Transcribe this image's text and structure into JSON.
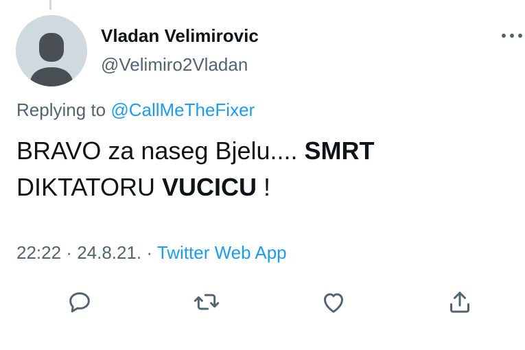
{
  "author": {
    "display_name": "Vladan Velimirovic",
    "handle": "@Velimiro2Vladan"
  },
  "reply": {
    "prefix": "Replying to ",
    "mention": "@CallMeTheFixer"
  },
  "tweet": {
    "text_part1": "BRAVO za naseg Bjelu.... ",
    "text_bold1": "SMRT",
    "text_part2": "DIKTATORU ",
    "text_bold2": "VUCICU",
    "text_part3": " !"
  },
  "meta": {
    "time": "22:22",
    "separator": " · ",
    "date": "24.8.21.",
    "source": "Twitter Web App"
  },
  "icons": {
    "more": "more-horizontal-icon",
    "reply": "reply-icon",
    "retweet": "retweet-icon",
    "like": "like-icon",
    "share": "share-icon"
  },
  "colors": {
    "text": "#0f1419",
    "secondary": "#536471",
    "link": "#1d9bf0",
    "avatar_bg": "#cfd9de",
    "avatar_fg": "#4a4f54"
  }
}
